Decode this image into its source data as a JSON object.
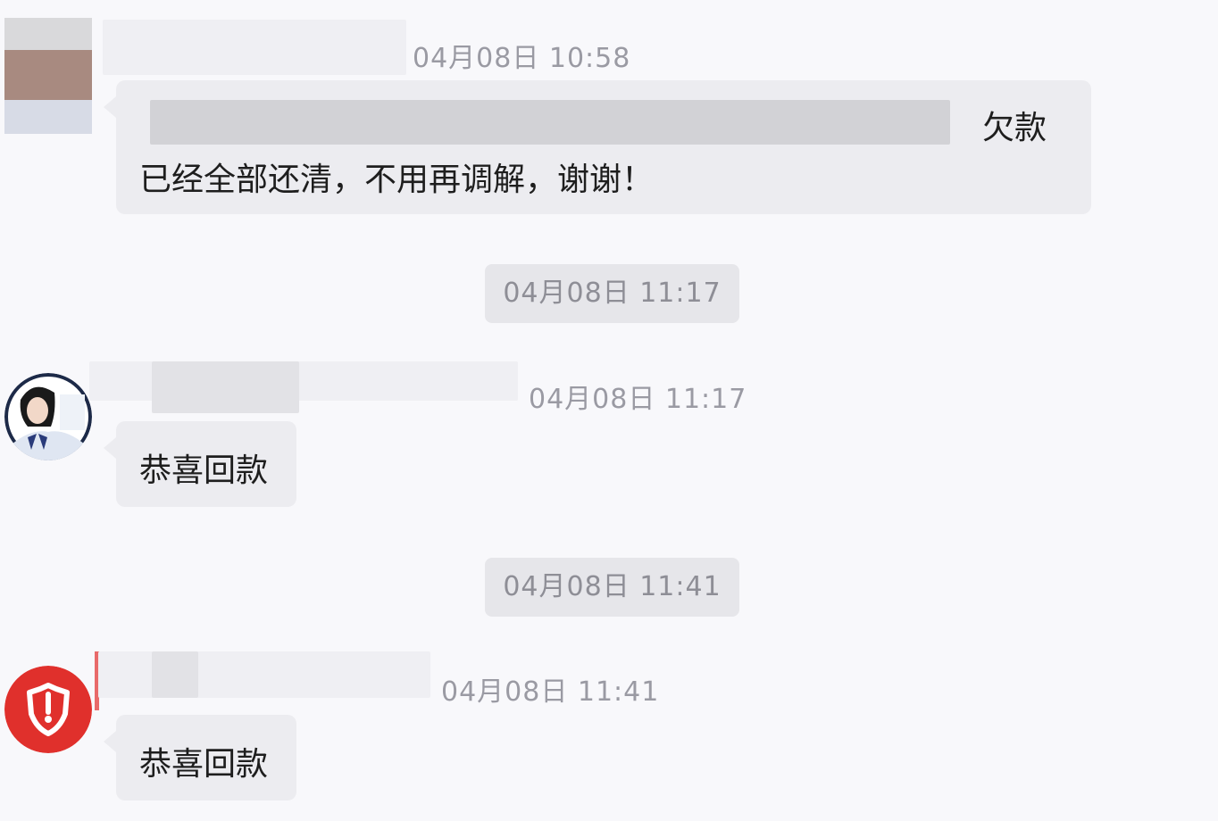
{
  "messages": [
    {
      "timestamp": "04月08日 10:58",
      "trailing_text": "欠款",
      "body": "已经全部还清，不用再调解，谢谢！"
    },
    {
      "timestamp": "04月08日 11:17",
      "body": "恭喜回款"
    },
    {
      "timestamp": "04月08日 11:41",
      "body": "恭喜回款"
    }
  ],
  "system_timestamps": [
    "04月08日 11:17",
    "04月08日 11:41"
  ],
  "icons": {
    "user_avatar": "blurred-user-avatar",
    "agent_avatar": "agent-avatar",
    "org_avatar": "shield-logo-icon"
  },
  "colors": {
    "background": "#f8f8fb",
    "bubble": "#ececf0",
    "logo_red": "#e0302c"
  }
}
